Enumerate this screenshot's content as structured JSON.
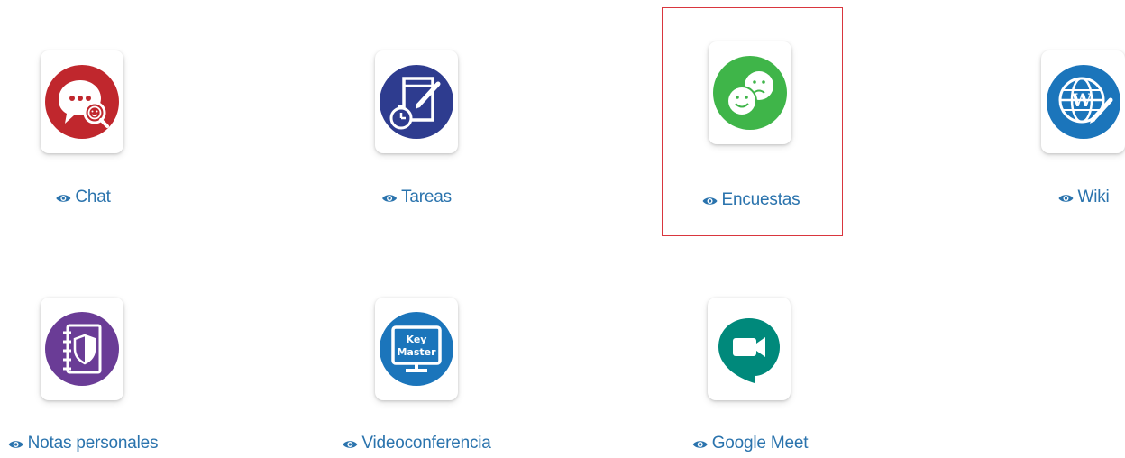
{
  "tools": [
    {
      "label": "Chat",
      "icon": "chat-icon",
      "color": "#c0272d"
    },
    {
      "label": "Tareas",
      "icon": "tasks-icon",
      "color": "#2e3c8f"
    },
    {
      "label": "Encuestas",
      "icon": "surveys-icon",
      "color": "#3fb549",
      "selected": true
    },
    {
      "label": "Wiki",
      "icon": "wiki-icon",
      "color": "#1b75bb"
    },
    {
      "label": "Notas personales",
      "icon": "personal-notes-icon",
      "color": "#6a3c96"
    },
    {
      "label": "Videoconferencia",
      "icon": "keymaster-icon",
      "color": "#1b75bb",
      "icon_text": [
        "Key",
        "Master"
      ]
    },
    {
      "label": "Google Meet",
      "icon": "google-meet-icon",
      "color": "#00897b"
    }
  ],
  "visibility_icon": "eye-icon",
  "link_color": "#2a73ad",
  "selection_border_color": "#d9363e"
}
